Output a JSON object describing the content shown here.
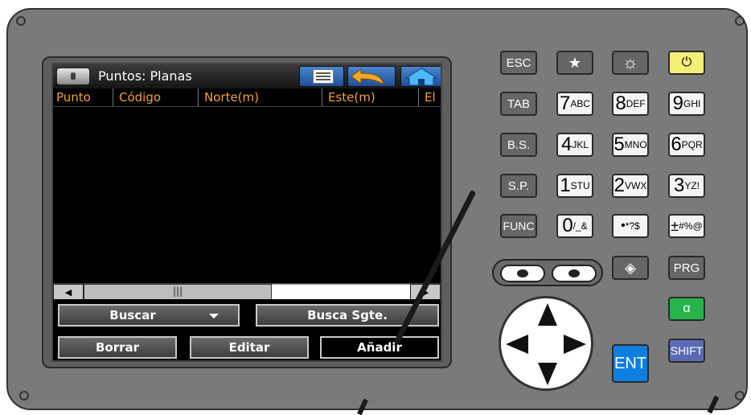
{
  "screen": {
    "title": "Puntos: Planas",
    "columns": [
      "Punto",
      "Código",
      "Norte(m)",
      "Este(m)",
      "El"
    ],
    "buttons": {
      "buscar": "Buscar",
      "busca_sgte": "Busca Sgte.",
      "borrar": "Borrar",
      "editar": "Editar",
      "anadir": "Añadir"
    }
  },
  "keypad": {
    "esc": "ESC",
    "star": "★",
    "light": "☼",
    "power": "⏻",
    "tab": "TAB",
    "bs": "B.S.",
    "sp": "S.P.",
    "func": "FUNC",
    "prg": "PRG",
    "alpha": "α",
    "shift": "SHIFT",
    "ent": "ENT",
    "target": "◈",
    "num_keys": [
      {
        "big": "7",
        "small": "ABC"
      },
      {
        "big": "8",
        "small": "DEF"
      },
      {
        "big": "9",
        "small": "GHI"
      },
      {
        "big": "4",
        "small": "JKL"
      },
      {
        "big": "5",
        "small": "MNO"
      },
      {
        "big": "6",
        "small": "PQR"
      },
      {
        "big": "1",
        "small": "STU"
      },
      {
        "big": "2",
        "small": "VWX"
      },
      {
        "big": "3",
        "small": "YZ!"
      },
      {
        "big": "0",
        "small": "/_&"
      },
      {
        "big": "•",
        "small": "*?$"
      },
      {
        "big": "±",
        "small": "#%@"
      }
    ]
  }
}
